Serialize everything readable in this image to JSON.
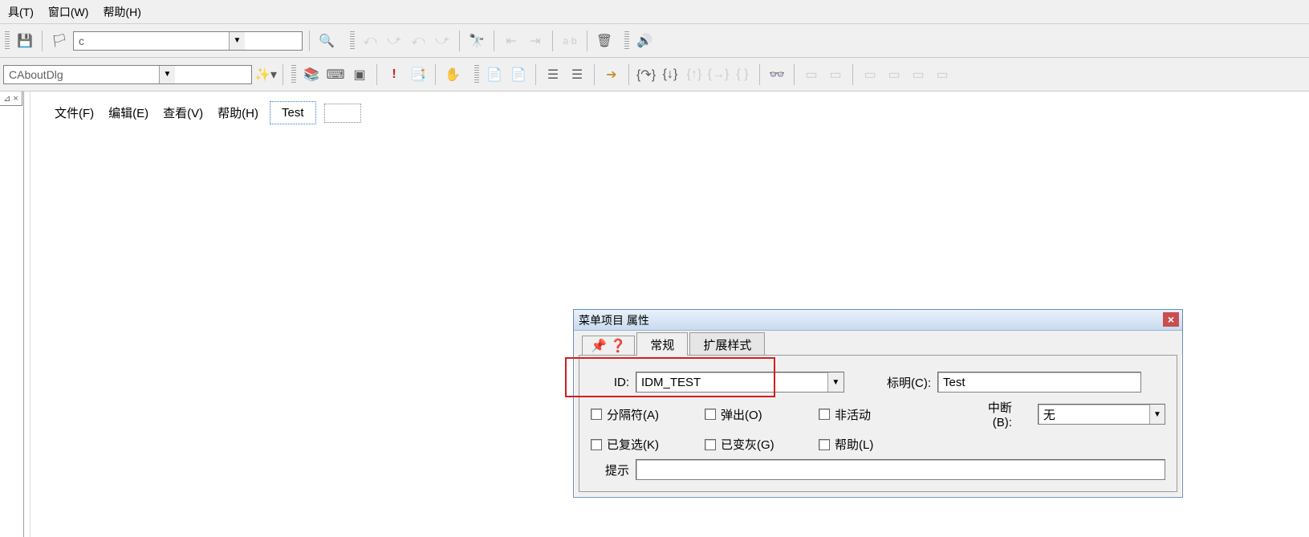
{
  "topmenu": {
    "tools": "具(T)",
    "window": "窗口(W)",
    "help": "帮助(H)"
  },
  "toolbar1": {
    "combo_value": "c"
  },
  "toolbar2": {
    "combo_value": "CAboutDlg"
  },
  "sidebar": {
    "tabstub": "⊿ ×"
  },
  "inner_menu": {
    "file": "文件(F)",
    "edit": "编辑(E)",
    "view": "查看(V)",
    "help": "帮助(H)",
    "test": "Test"
  },
  "dialog": {
    "title": "菜单项目 属性",
    "tabs": {
      "general": "常规",
      "extended": "扩展样式"
    },
    "id_label": "ID:",
    "id_value": "IDM_TEST",
    "caption_label": "标明(C):",
    "caption_value": "Test",
    "checks": {
      "separator": "分隔符(A)",
      "popup": "弹出(O)",
      "inactive": "非活动",
      "checked": "已复选(K)",
      "grayed": "已变灰(G)",
      "help": "帮助(L)"
    },
    "break_label": "中断(B):",
    "break_value": "无",
    "prompt_label": "提示"
  }
}
